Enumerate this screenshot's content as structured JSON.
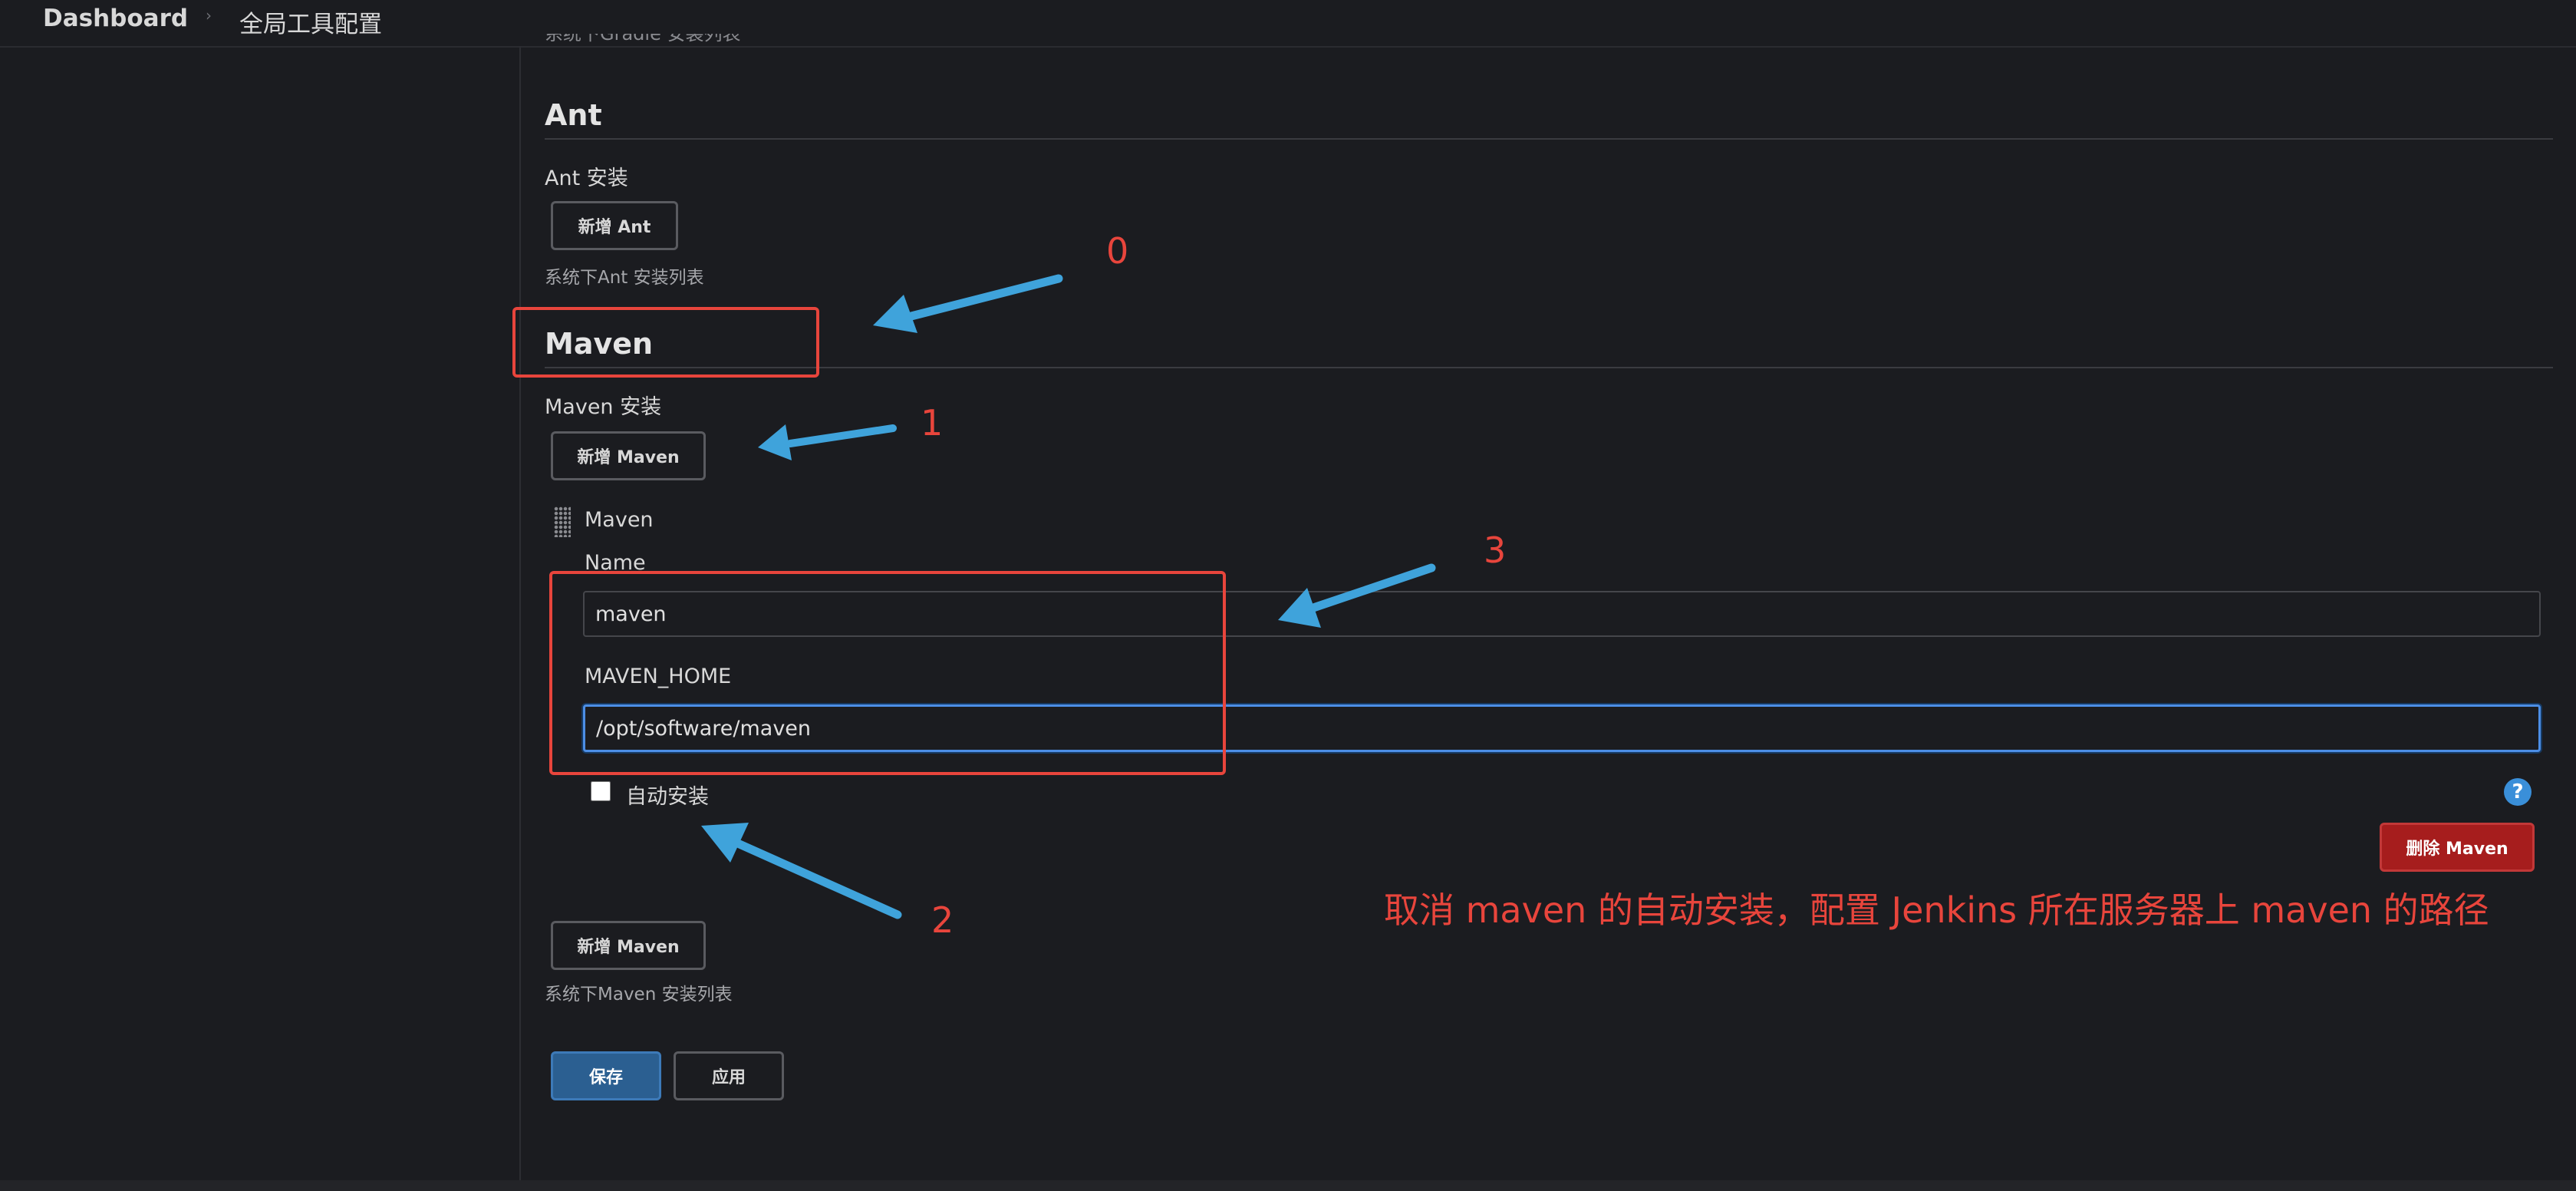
{
  "breadcrumb": {
    "dashboard": "Dashboard",
    "separator": "›",
    "current": "全局工具配置"
  },
  "cut_off_text": "系统下Gradle 安装列表",
  "ant": {
    "title": "Ant",
    "install_label": "Ant 安装",
    "add_button": "新增 Ant",
    "description": "系统下Ant 安装列表"
  },
  "maven": {
    "title": "Maven",
    "install_label": "Maven 安装",
    "add_button_top": "新增 Maven",
    "item_header": "Maven",
    "name_label": "Name",
    "name_value": "maven",
    "home_label": "MAVEN_HOME",
    "home_value": "/opt/software/maven",
    "auto_install_label": "自动安装",
    "auto_install_checked": false,
    "help_icon_text": "?",
    "delete_button": "删除 Maven",
    "add_button_bottom": "新增 Maven",
    "description": "系统下Maven 安装列表"
  },
  "actions": {
    "save": "保存",
    "apply": "应用"
  },
  "annotations": {
    "numbers": [
      "0",
      "1",
      "2",
      "3"
    ],
    "note": "取消 maven 的自动安装，配置 Jenkins 所在服务器上 maven 的路径",
    "box_color": "#e8453c",
    "arrow_color": "#3fa3db"
  },
  "icons": {
    "drag": "drag-handle-icon",
    "help": "help-icon",
    "breadcrumb_sep": "chevron-right-icon"
  },
  "colors": {
    "background": "#1b1c20",
    "primary": "#2b5f91",
    "danger": "#a61d1d",
    "focus": "#4c8ee6"
  }
}
